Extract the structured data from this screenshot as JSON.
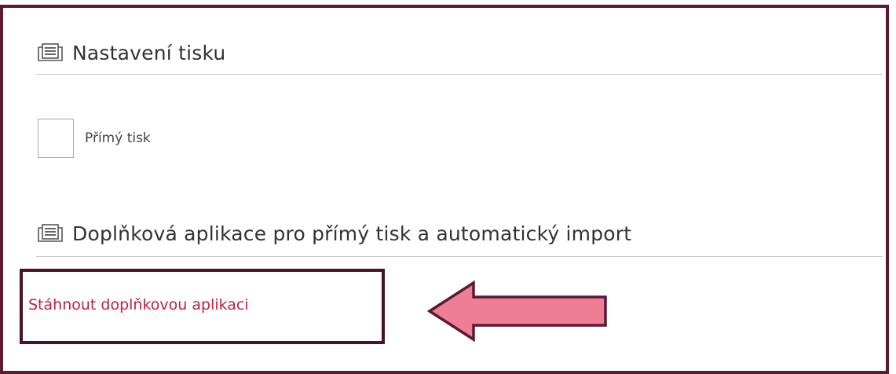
{
  "print_settings": {
    "title": "Nastavení tisku",
    "icon": "printer-icon"
  },
  "direct_print": {
    "label": "Přímý tisk",
    "checked": false
  },
  "addon_app": {
    "title": "Doplňková aplikace pro přímý tisk a automatický import",
    "icon": "printer-icon",
    "download_link": "Stáhnout doplňkovou aplikaci"
  },
  "colors": {
    "frame": "#5a1a30",
    "highlight_box": "#4a1228",
    "link": "#c0203f",
    "arrow_fill": "#ee7d95",
    "arrow_stroke": "#5a1a30"
  }
}
